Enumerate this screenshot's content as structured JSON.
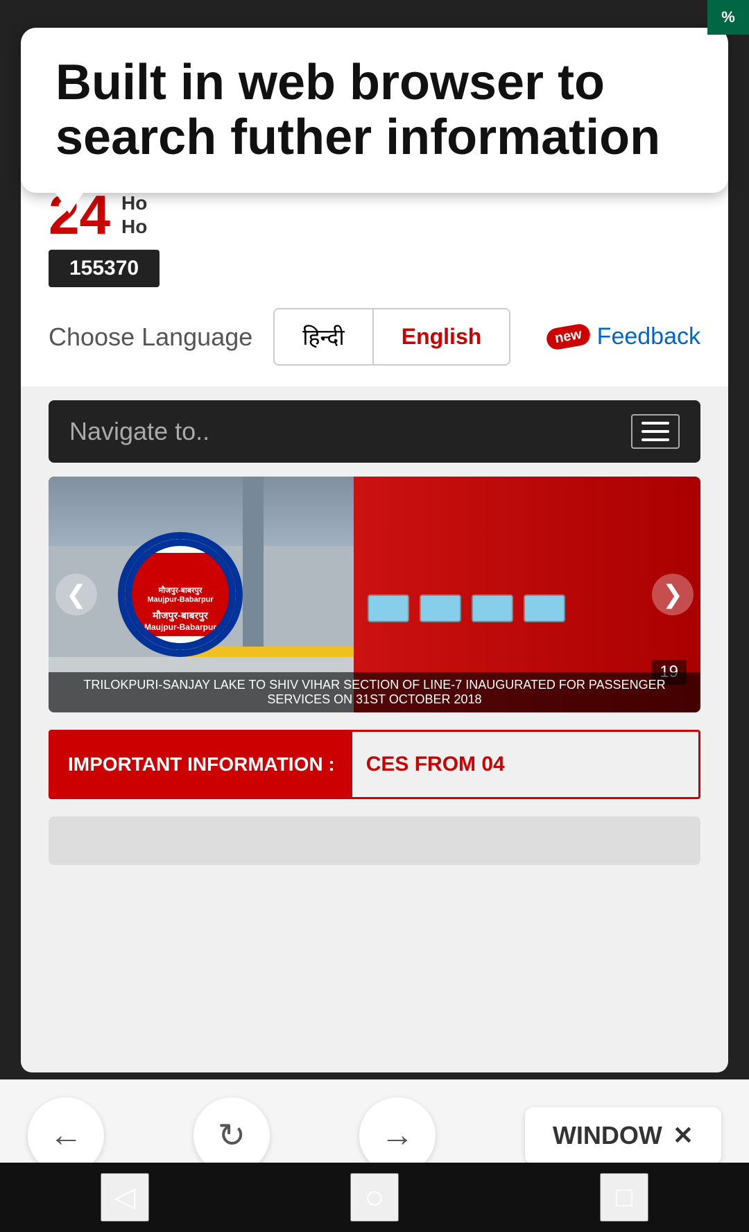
{
  "status_bar": {
    "text": "%"
  },
  "tooltip": {
    "text": "Built in web browser to search futher information"
  },
  "header": {
    "helpline_number": "24",
    "helpline_label_line1": "Ho",
    "helpline_label_line2": "Ho",
    "helpline_code": "155370"
  },
  "language": {
    "label": "Choose Language",
    "hindi": "हिन्दी",
    "english": "English",
    "feedback_new_badge": "new",
    "feedback_label": "Feedback"
  },
  "navigate": {
    "placeholder": "Navigate to.."
  },
  "metro_image": {
    "station_name_hi": "मौजपुर-बाबरपुर",
    "station_name_en": "Maujpur-Babarpur",
    "caption": "TRILOKPURI-SANJAY LAKE TO SHIV VIHAR SECTION OF LINE-7 INAUGURATED FOR PASSENGER SERVICES ON 31ST OCTOBER 2018",
    "counter": "19",
    "arrow_left": "❮",
    "arrow_right": "❯"
  },
  "important_info": {
    "label": "IMPORTANT INFORMATION :",
    "content": "CES FROM 04"
  },
  "browser_nav": {
    "back": "←",
    "refresh": "↻",
    "forward": "→",
    "window_label": "WINDOW",
    "window_close": "✕"
  },
  "android_nav": {
    "back_icon": "◁",
    "home_icon": "○",
    "recents_icon": "□"
  }
}
